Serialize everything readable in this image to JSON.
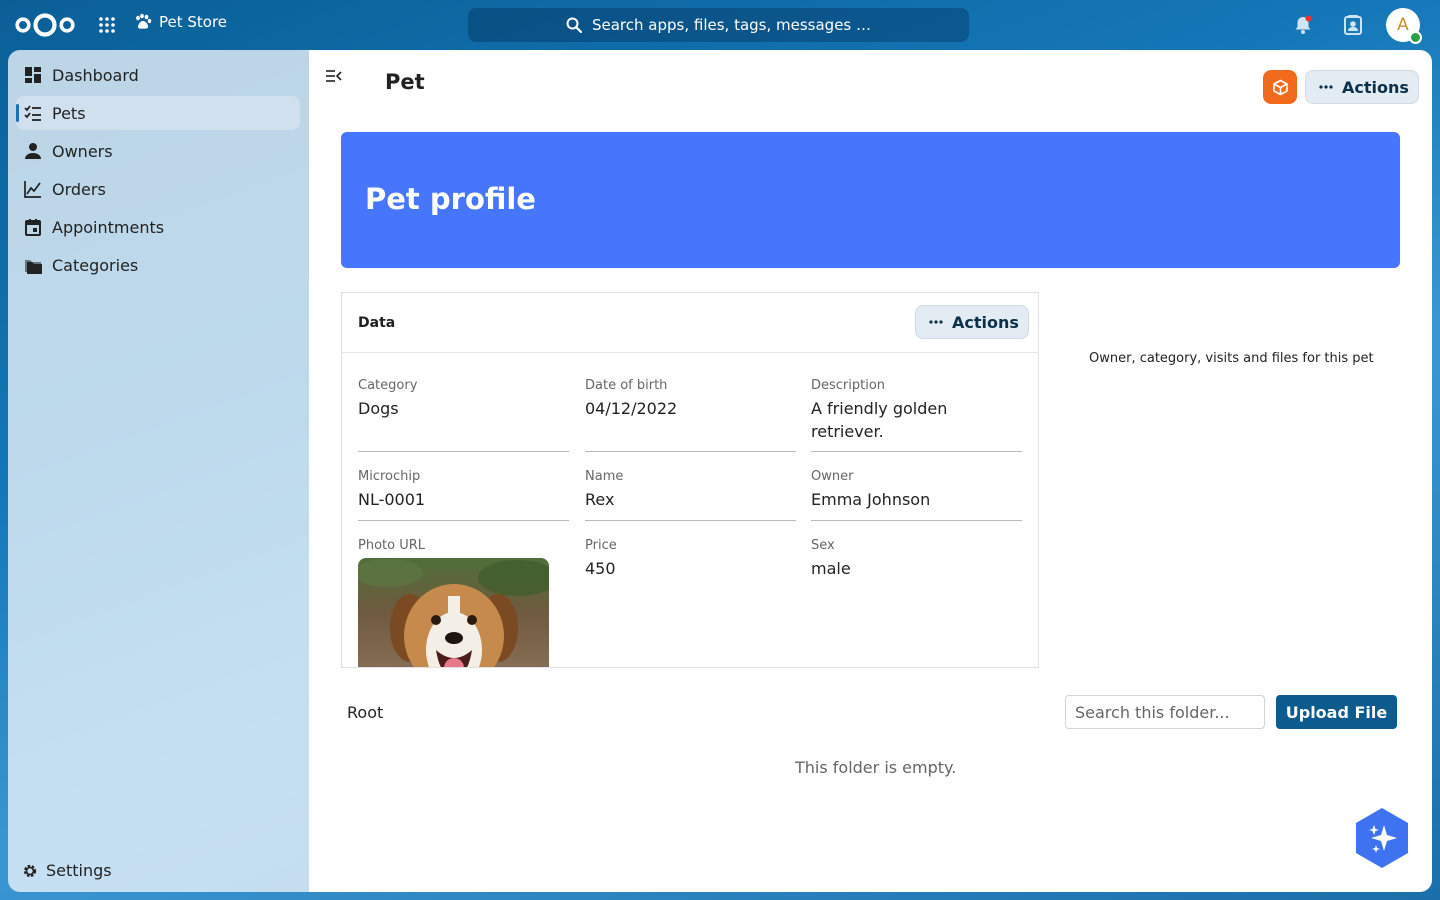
{
  "topbar": {
    "app_name": "Pet Store",
    "search_placeholder": "Search apps, files, tags, messages …",
    "avatar_initial": "A"
  },
  "sidebar": {
    "items": [
      {
        "label": "Dashboard",
        "icon": "dashboard-icon"
      },
      {
        "label": "Pets",
        "icon": "checklist-icon",
        "active": true
      },
      {
        "label": "Owners",
        "icon": "person-icon"
      },
      {
        "label": "Orders",
        "icon": "chart-line-icon"
      },
      {
        "label": "Appointments",
        "icon": "calendar-icon"
      },
      {
        "label": "Categories",
        "icon": "folders-icon"
      }
    ],
    "settings_label": "Settings"
  },
  "page": {
    "title": "Pet",
    "actions_label": "Actions",
    "hero_title": "Pet profile"
  },
  "data_card": {
    "title": "Data",
    "actions_label": "Actions",
    "fields": {
      "category": {
        "label": "Category",
        "value": "Dogs"
      },
      "date_of_birth": {
        "label": "Date of birth",
        "value": "04/12/2022"
      },
      "description": {
        "label": "Description",
        "value": "A friendly golden retriever."
      },
      "microchip": {
        "label": "Microchip",
        "value": "NL-0001"
      },
      "name": {
        "label": "Name",
        "value": "Rex"
      },
      "owner": {
        "label": "Owner",
        "value": "Emma Johnson"
      },
      "photo_url": {
        "label": "Photo URL"
      },
      "price": {
        "label": "Price",
        "value": "450"
      },
      "sex": {
        "label": "Sex",
        "value": "male"
      }
    }
  },
  "side_note": "Owner, category, visits and files for this pet",
  "files": {
    "root_label": "Root",
    "search_placeholder": "Search this folder...",
    "upload_label": "Upload File",
    "empty_message": "This folder is empty."
  },
  "colors": {
    "primary": "#0b5b8e",
    "hero": "#4676fb",
    "accent_orange": "#f26a1b"
  }
}
